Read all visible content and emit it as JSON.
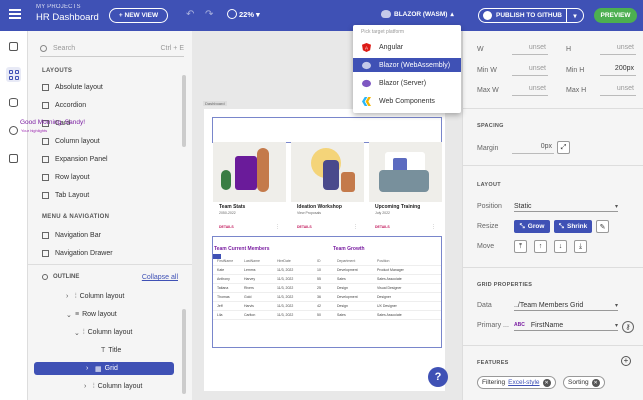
{
  "header": {
    "project_label": "MY PROJECTS",
    "app_title": "HR Dashboard",
    "new_view_label": "+ NEW VIEW",
    "zoom": "22%",
    "platform_label": "BLAZOR (WASM)",
    "publish_label": "PUBLISH TO GITHUB",
    "preview_label": "PREVIEW"
  },
  "platform_menu": {
    "header": "Pick target platform",
    "items": [
      {
        "label": "Angular",
        "icon": "angular-icon",
        "selected": false
      },
      {
        "label": "Blazor (WebAssembly)",
        "icon": "blazor-icon",
        "selected": true
      },
      {
        "label": "Blazor (Server)",
        "icon": "blazor-icon",
        "selected": false
      },
      {
        "label": "Web Components",
        "icon": "webcomponents-icon",
        "selected": false
      }
    ]
  },
  "left_panel": {
    "search_placeholder": "Search",
    "search_hint": "Ctrl + E",
    "layouts_title": "LAYOUTS",
    "layouts": [
      "Absolute layout",
      "Accordion",
      "Card",
      "Column layout",
      "Expansion Panel",
      "Row layout",
      "Tab Layout"
    ],
    "nav_title": "MENU & NAVIGATION",
    "nav_items": [
      "Navigation Bar",
      "Navigation Drawer"
    ],
    "outline_title": "OUTLINE",
    "collapse_all": "Collapse all",
    "tree": [
      {
        "label": "Column layout",
        "indent": 1,
        "arrow": "›"
      },
      {
        "label": "Row layout",
        "indent": 1,
        "arrow": "⌄"
      },
      {
        "label": "Column layout",
        "indent": 2,
        "arrow": "⌄"
      },
      {
        "label": "Title",
        "indent": 3,
        "arrow": ""
      },
      {
        "label": "Grid",
        "indent": 3,
        "arrow": "›",
        "selected": true
      },
      {
        "label": "Column layout",
        "indent": 2,
        "arrow": "›"
      }
    ]
  },
  "canvas": {
    "tag": "Dashboard",
    "greeting": "Good Morning, Sandy!",
    "greeting_sub": "Your highlights",
    "cards": [
      {
        "name": "Team Stats",
        "date": "2050-2022",
        "details": "DETAILS"
      },
      {
        "name": "Ideation Workshop",
        "date": "View Proposals",
        "details": "DETAILS"
      },
      {
        "name": "Upcoming Training",
        "date": "July 2022",
        "details": "DETAILS"
      }
    ],
    "members_title": "Team Current Members",
    "growth_title": "Team Growth",
    "grid_headers": [
      "FirstName",
      "LastName",
      "HireDate",
      "ID",
      "Department",
      "Position"
    ],
    "grid_rows": [
      [
        "Kate",
        "Lemms",
        "11/3, 2022",
        "10",
        "Development",
        "Product Manager"
      ],
      [
        "Anthony",
        "Harvey",
        "11/3, 2022",
        "55",
        "Sales",
        "Sales Associate"
      ],
      [
        "Tatiana",
        "Rivers",
        "11/3, 2022",
        "25",
        "Design",
        "Visual Designer"
      ],
      [
        "Thomas",
        "Gold",
        "11/3, 2022",
        "36",
        "Development",
        "Designer"
      ],
      [
        "Jeff",
        "Harvis",
        "11/3, 2022",
        "42",
        "Design",
        "UX Designer"
      ],
      [
        "Lila",
        "Carlton",
        "11/3, 2022",
        "50",
        "Sales",
        "Sales Associate"
      ]
    ],
    "help_label": "?"
  },
  "right_panel": {
    "w_label": "W",
    "w_value": "unset",
    "h_label": "H",
    "h_value": "unset",
    "minw_label": "Min W",
    "minw_value": "unset",
    "minh_label": "Min H",
    "minh_value": "200px",
    "maxw_label": "Max W",
    "maxw_value": "unset",
    "maxh_label": "Max H",
    "maxh_value": "unset",
    "spacing_title": "SPACING",
    "margin_label": "Margin",
    "margin_value": "0px",
    "layout_title": "LAYOUT",
    "position_label": "Position",
    "position_value": "Static",
    "resize_label": "Resize",
    "grow_label": "Grow",
    "shrink_label": "Shrink",
    "move_label": "Move",
    "grid_props_title": "GRID PROPERTIES",
    "data_label": "Data",
    "data_value": "../Team Members Grid",
    "primary_label": "Primary ...",
    "primary_badge": "ABC",
    "primary_value": "FirstName",
    "features_title": "FEATURES",
    "features": [
      {
        "label": "Filtering",
        "link": "Excel-style"
      },
      {
        "label": "Sorting",
        "link": ""
      }
    ]
  },
  "colors": {
    "primary": "#3f51b5",
    "preview": "#4caf50",
    "accent_purple": "#7b1fa2"
  }
}
